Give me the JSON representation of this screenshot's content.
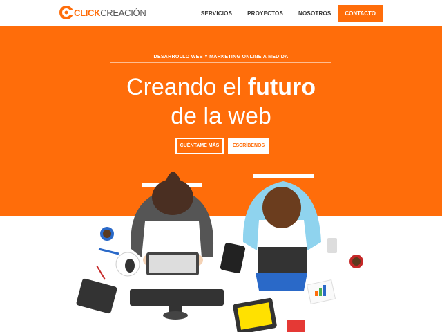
{
  "brand": {
    "bold": "CLICK",
    "light": "CREACIÓN",
    "accent": "#ff6d0a"
  },
  "nav": {
    "items": [
      "SERVICIOS",
      "PROYECTOS",
      "NOSOTROS"
    ],
    "cta": "CONTACTO"
  },
  "hero": {
    "kicker": "DESARROLLO WEB Y MARKETING ONLINE A MEDIDA",
    "line1_pre": "Creando el ",
    "line1_bold": "futuro",
    "line2": "de la web",
    "btn_primary": "CUÉNTAME MÁS",
    "btn_secondary": "ESCRÍBENOS"
  },
  "icons": [
    "logo-c-icon",
    "coffee-cup-icon",
    "pen-icon",
    "mouse-icon",
    "keyboard-icon",
    "smartphone-icon",
    "laptop-icon",
    "ipod-icon",
    "document-chart-icon",
    "tablet-icon",
    "monitor-icon",
    "notebook-icon"
  ]
}
